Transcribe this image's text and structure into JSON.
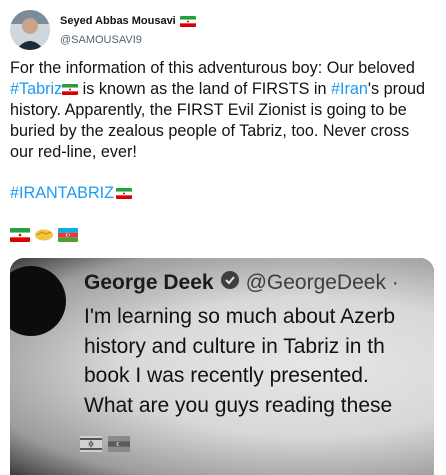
{
  "tweet": {
    "author_name": "Seyed Abbas Mousavi",
    "author_handle": "@SAMOUSAVI9",
    "text_parts": {
      "p1": "For the information of this adventurous boy: Our beloved ",
      "tag_tabriz": "#Tabriz",
      "p2": " is known as the land of FIRSTS in ",
      "tag_iran": "#Iran",
      "p3": "'s proud history.  Apparently, the FIRST Evil Zionist is going to be buried by the zealous people of Tabriz, too. Never cross our red-line, ever!"
    },
    "hashtag": "#IRANTABRIZ",
    "emoji_row": [
      "iran-flag-icon",
      "handshake-icon",
      "azerbaijan-flag-icon"
    ]
  },
  "embedded_screenshot": {
    "name": "George Deek",
    "handle": "@GeorgeDeek ·",
    "lines": [
      "I'm learning so much about Azerb",
      "history and culture in Tabriz in th",
      "book I was recently presented.",
      "What are you guys reading these"
    ]
  },
  "colors": {
    "link": "#1d9bf0",
    "text": "#0f1419",
    "muted": "#536471"
  }
}
